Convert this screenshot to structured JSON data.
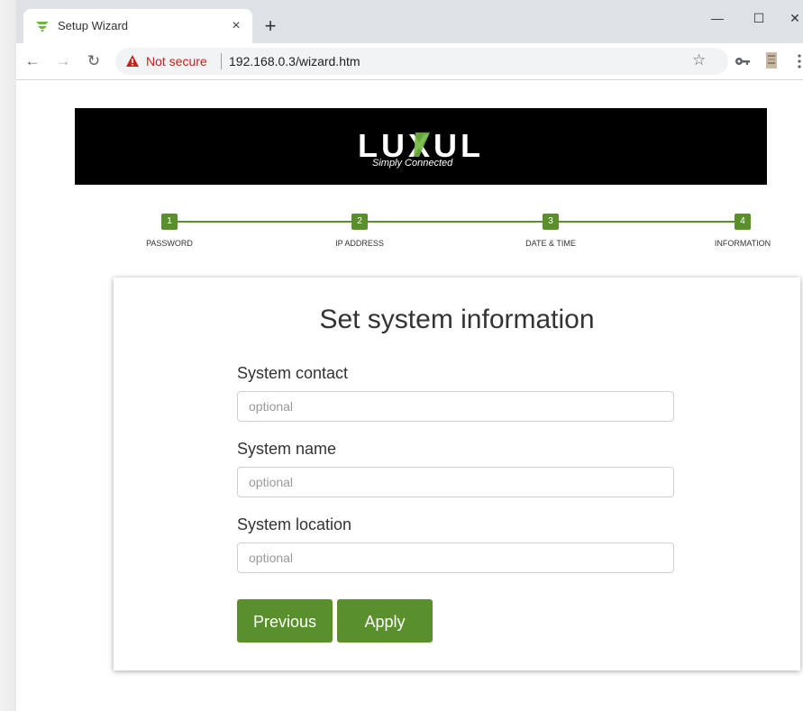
{
  "browser": {
    "tab_title": "Setup Wizard",
    "tab_close": "×",
    "new_tab": "+",
    "security_label": "Not secure",
    "url": "192.168.0.3/wizard.htm",
    "minimize": "—",
    "maximize": "☐",
    "close": "✕",
    "back": "←",
    "forward": "→",
    "reload": "↻",
    "bookmark": "☆"
  },
  "banner": {
    "brand": "LUXUL",
    "tagline": "Simply Connected",
    "colors": {
      "background": "#000000",
      "logo": "#ffffff",
      "accent": "#6fb63e"
    }
  },
  "steps": [
    {
      "number": "1",
      "label": "PASSWORD"
    },
    {
      "number": "2",
      "label": "IP ADDRESS"
    },
    {
      "number": "3",
      "label": "DATE & TIME"
    },
    {
      "number": "4",
      "label": "INFORMATION"
    }
  ],
  "form": {
    "title": "Set system information",
    "fields": [
      {
        "label": "System contact",
        "placeholder": "optional",
        "value": ""
      },
      {
        "label": "System name",
        "placeholder": "optional",
        "value": ""
      },
      {
        "label": "System location",
        "placeholder": "optional",
        "value": ""
      }
    ],
    "previous_label": "Previous",
    "apply_label": "Apply"
  },
  "colors": {
    "accent": "#5a8f2d",
    "warning": "#c5221f"
  }
}
